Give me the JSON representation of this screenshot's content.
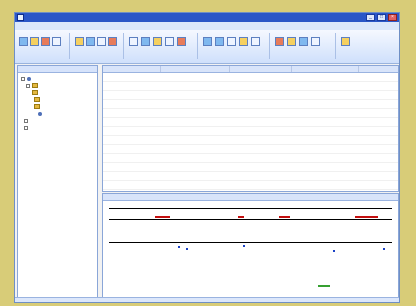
{
  "window": {
    "title": "",
    "controls": [
      "_",
      "□",
      "×"
    ]
  },
  "menu": [
    "",
    "",
    "",
    "",
    ""
  ],
  "tree": {
    "header": "",
    "items": [
      "",
      "",
      "",
      "",
      "",
      "",
      "",
      ""
    ]
  },
  "grid": {
    "headers": [
      "",
      "",
      "",
      "",
      ""
    ],
    "rows": [
      [
        "",
        "",
        "",
        "",
        ""
      ],
      [
        "",
        "",
        "",
        "",
        ""
      ],
      [
        "",
        "",
        "",
        "",
        ""
      ],
      [
        "",
        "",
        "",
        "",
        ""
      ],
      [
        "",
        "",
        "",
        "",
        ""
      ],
      [
        "",
        "",
        "",
        "",
        ""
      ],
      [
        "",
        "",
        "",
        "",
        ""
      ],
      [
        "",
        "",
        "",
        "",
        ""
      ],
      [
        "",
        "",
        "",
        "",
        ""
      ],
      [
        "",
        "",
        "",
        "",
        ""
      ],
      [
        "",
        "",
        "",
        "",
        ""
      ],
      [
        "",
        "",
        "",
        "",
        ""
      ],
      [
        "",
        "",
        "",
        "",
        ""
      ],
      [
        "",
        "",
        "",
        "",
        ""
      ]
    ]
  },
  "sequence_view": {
    "title": "",
    "ticks": [
      "",
      "",
      "",
      ""
    ],
    "tracks": [
      "",
      "",
      ""
    ]
  }
}
